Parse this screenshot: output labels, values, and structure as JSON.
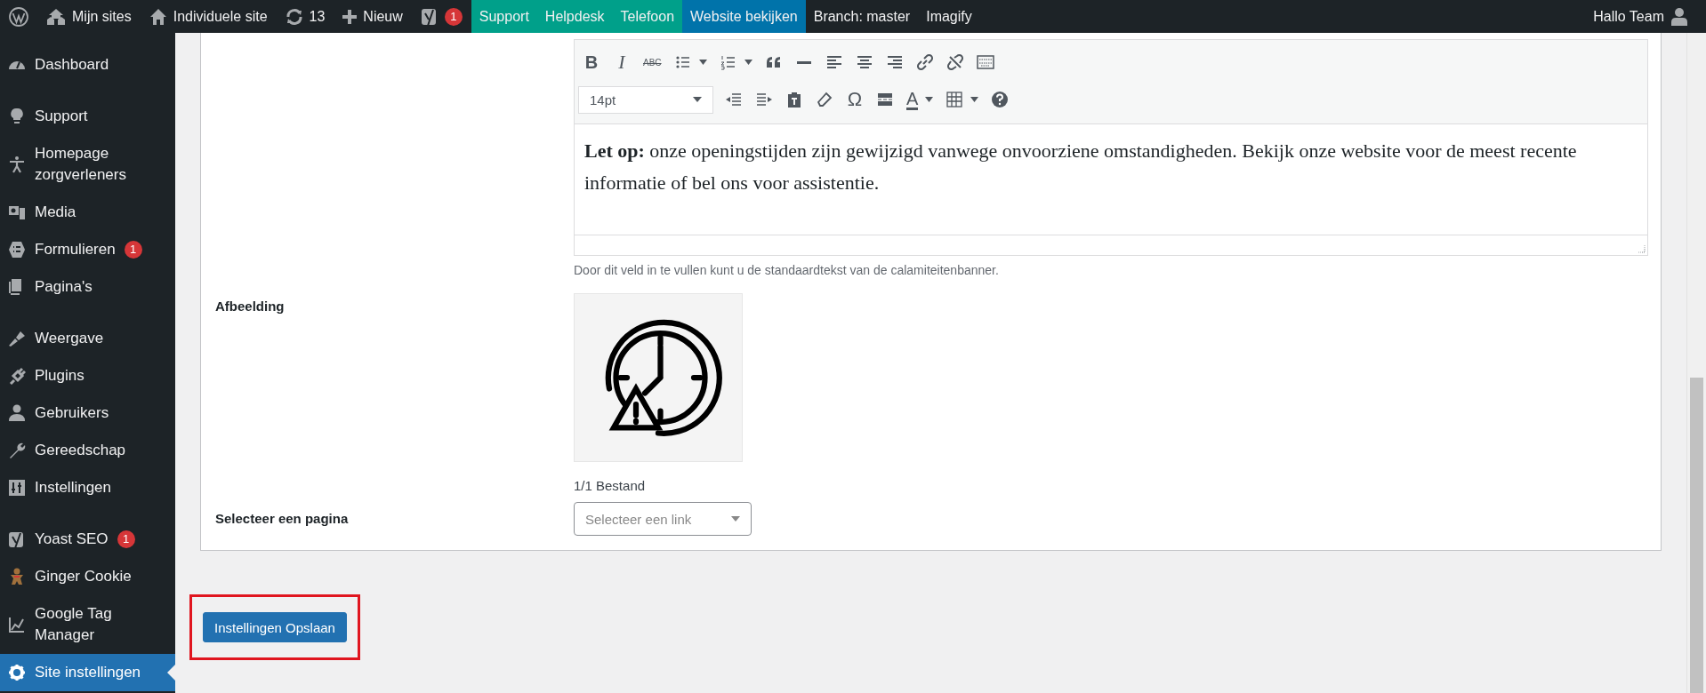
{
  "admin_bar": {
    "items": [
      {
        "kind": "wp"
      },
      {
        "kind": "sites",
        "label": "Mijn sites"
      },
      {
        "kind": "home",
        "label": "Individuele site"
      },
      {
        "kind": "updates",
        "label": "13"
      },
      {
        "kind": "new",
        "label": "Nieuw"
      },
      {
        "kind": "yoast",
        "badge": "1"
      },
      {
        "kind": "link",
        "label": "Support",
        "color": "#00a08a"
      },
      {
        "kind": "link",
        "label": "Helpdesk",
        "color": "#00a08a"
      },
      {
        "kind": "link",
        "label": "Telefoon",
        "color": "#00a08a"
      },
      {
        "kind": "link",
        "label": "Website bekijken",
        "color": "#0073aa"
      },
      {
        "kind": "link",
        "label": "Branch: master"
      },
      {
        "kind": "link",
        "label": "Imagify"
      }
    ],
    "account": "Hallo Team"
  },
  "sidebar": {
    "groups": [
      [
        {
          "label": "Dashboard",
          "selected": false
        }
      ],
      [
        {
          "label": "Support",
          "selected": false
        },
        {
          "label": "Homepage zorgverleners",
          "selected": false
        },
        {
          "label": "Media",
          "selected": false
        },
        {
          "label": "Formulieren",
          "badge": "1",
          "selected": false
        },
        {
          "label": "Pagina's",
          "selected": false
        }
      ],
      [
        {
          "label": "Weergave",
          "selected": false
        },
        {
          "label": "Plugins",
          "selected": false
        },
        {
          "label": "Gebruikers",
          "selected": false
        },
        {
          "label": "Gereedschap",
          "selected": false
        },
        {
          "label": "Instellingen",
          "selected": false
        }
      ],
      [
        {
          "label": "Yoast SEO",
          "badge": "1",
          "selected": false
        },
        {
          "label": "Ginger Cookie",
          "selected": false
        },
        {
          "label": "Google Tag Manager",
          "selected": false
        },
        {
          "label": "Site instellingen",
          "selected": true
        }
      ]
    ]
  },
  "editor": {
    "toolbar_rows": [
      [
        {
          "kind": "bold",
          "glyph": "B"
        },
        {
          "kind": "italic",
          "glyph": "I"
        },
        {
          "kind": "strike",
          "glyph": "ABC"
        },
        {
          "kind": "bullist",
          "caret": true
        },
        {
          "kind": "numlist",
          "caret": true
        },
        {
          "kind": "quote"
        },
        {
          "kind": "hr"
        },
        {
          "kind": "alignleft"
        },
        {
          "kind": "aligncenter"
        },
        {
          "kind": "alignright"
        },
        {
          "kind": "link"
        },
        {
          "kind": "unlink"
        },
        {
          "kind": "kitchen"
        }
      ],
      [
        {
          "kind": "select",
          "value": "14pt"
        },
        {
          "kind": "outdent"
        },
        {
          "kind": "indent"
        },
        {
          "kind": "paste"
        },
        {
          "kind": "eraser"
        },
        {
          "kind": "special-character",
          "glyph": "Ω"
        },
        {
          "kind": "more"
        },
        {
          "kind": "text-color",
          "glyph": "A",
          "caret": true
        },
        {
          "kind": "table",
          "caret": true
        },
        {
          "kind": "help"
        }
      ]
    ],
    "content": "**Let op:** onze openingstijden zijn gewijzigd vanwege onvoorziene omstandigheden. Bekijk onze website voor de meest recente informatie of bel ons voor assistentie.",
    "help": "Door dit veld in te vullen kunt u de standaardtekst van de calamiteitenbanner."
  },
  "image_field": {
    "label": "Afbeelding",
    "count": "1/1 Bestand"
  },
  "page_field": {
    "label": "Selecteer een pagina",
    "placeholder": "Selecteer een link"
  },
  "save_button": {
    "label": "Instellingen Opslaan",
    "highlighted": true
  }
}
